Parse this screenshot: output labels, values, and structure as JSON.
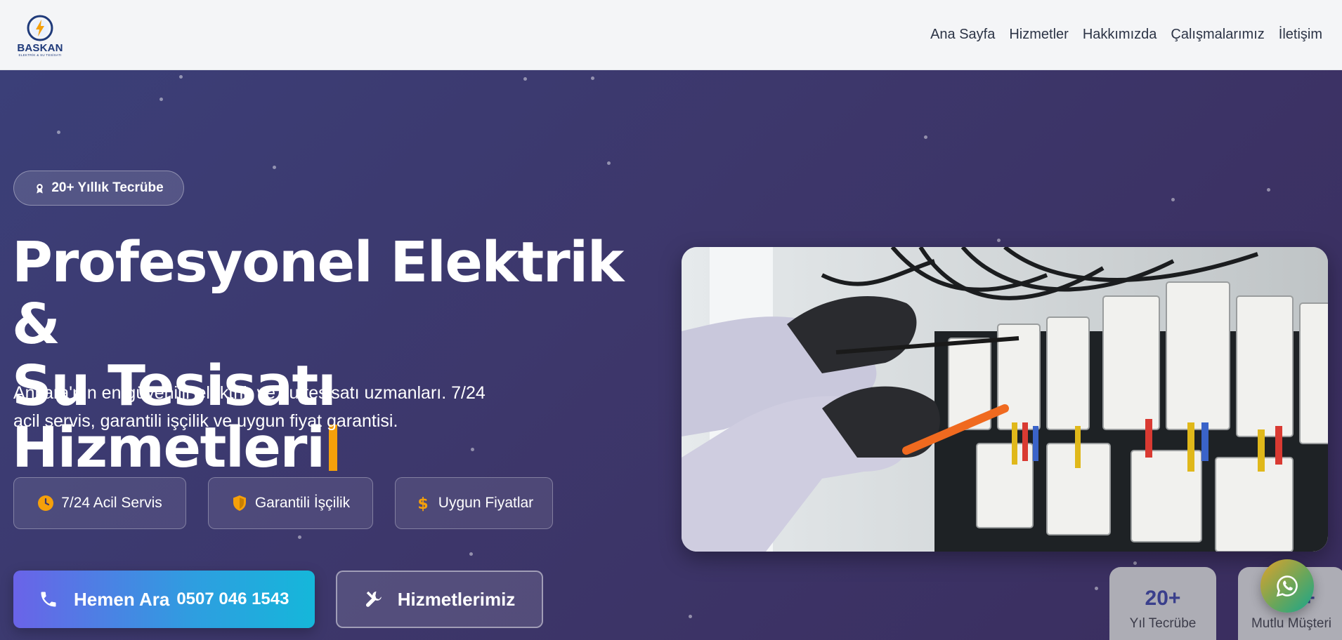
{
  "header": {
    "brand": "BASKAN",
    "tagline": "ELEKTRİK & SU TESİSATI",
    "nav": [
      "Ana Sayfa",
      "Hizmetler",
      "Hakkımızda",
      "Çalışmalarımız",
      "İletişim"
    ]
  },
  "hero": {
    "badge": "20+ Yıllık Tecrübe",
    "title_line1": "Profesyonel Elektrik &",
    "title_line2": "Su Tesisatı Hizmetleri",
    "subtitle_line1": "Ankara'nın en güvenilir elektrik ve su tesisatı uzmanları. 7/24",
    "subtitle_line2": "acil servis, garantili işçilik ve uygun fiyat garantisi.",
    "features": [
      "7/24 Acil Servis",
      "Garantili İşçilik",
      "Uygun Fiyatlar"
    ],
    "call_label": "Hemen Ara",
    "call_phone": "0507 046 1543",
    "services_label": "Hizmetlerimiz"
  },
  "stats": [
    {
      "num": "20+",
      "label": "Yıl Tecrübe"
    },
    {
      "num": "500+",
      "label": "Mutlu Müşteri"
    }
  ],
  "colors": {
    "accent": "#f5a00a",
    "brand": "#1f3a7a",
    "hero_bg": "#3d376b",
    "call_gradient_start": "#6a63e8",
    "call_gradient_end": "#15b7da"
  },
  "icons": {
    "badge": "award-icon",
    "features": [
      "clock-icon",
      "shield-icon",
      "dollar-icon"
    ],
    "call": "phone-icon",
    "services": "tools-icon",
    "floating": "whatsapp-icon"
  }
}
